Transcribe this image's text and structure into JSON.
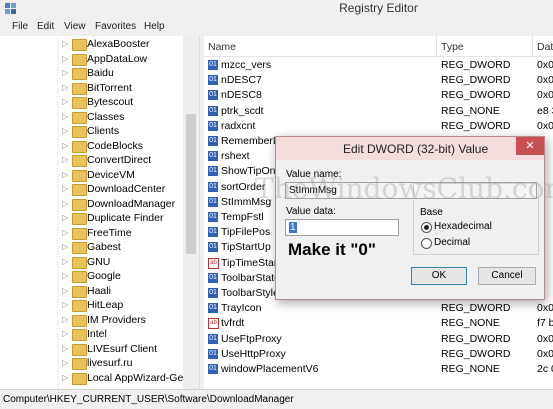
{
  "window": {
    "title": "Registry Editor"
  },
  "menu": [
    "File",
    "Edit",
    "View",
    "Favorites",
    "Help"
  ],
  "tree": {
    "items": [
      "AlexaBooster",
      "AppDataLow",
      "Baidu",
      "BitTorrent",
      "Bytescout",
      "Classes",
      "Clients",
      "CodeBlocks",
      "ConvertDirect",
      "DeviceVM",
      "DownloadCenter",
      "DownloadManager",
      "Duplicate Finder",
      "FreeTime",
      "Gabest",
      "GNU",
      "Google",
      "Haali",
      "HitLeap",
      "IM Providers",
      "Intel",
      "LIVEsurf Client",
      "livesurf.ru",
      "Local AppWizard-Gene"
    ]
  },
  "list": {
    "headers": {
      "name": "Name",
      "type": "Type",
      "data": "Data"
    },
    "rows": [
      {
        "icon": "dword-icon",
        "name": "mzcc_vers",
        "type": "REG_DWORD",
        "data": "0x0"
      },
      {
        "icon": "dword-icon",
        "name": "nDESC7",
        "type": "REG_DWORD",
        "data": "0x0"
      },
      {
        "icon": "dword-icon",
        "name": "nDESC8",
        "type": "REG_DWORD",
        "data": "0x0"
      },
      {
        "icon": "dword-icon",
        "name": "ptrk_scdt",
        "type": "REG_NONE",
        "data": "e8 3"
      },
      {
        "icon": "dword-icon",
        "name": "radxcnt",
        "type": "REG_DWORD",
        "data": "0x0"
      },
      {
        "icon": "dword-icon",
        "name": "RememberL",
        "type": "",
        "data": ""
      },
      {
        "icon": "dword-icon",
        "name": "rshext",
        "type": "",
        "data": ""
      },
      {
        "icon": "dword-icon",
        "name": "ShowTipOnF",
        "type": "",
        "data": ""
      },
      {
        "icon": "dword-icon",
        "name": "sortOrder",
        "type": "",
        "data": ""
      },
      {
        "icon": "dword-icon",
        "name": "StImmMsg",
        "type": "",
        "data": ""
      },
      {
        "icon": "dword-icon",
        "name": "TempFstl",
        "type": "",
        "data": ""
      },
      {
        "icon": "dword-icon",
        "name": "TipFilePos",
        "type": "",
        "data": ""
      },
      {
        "icon": "dword-icon",
        "name": "TipStartUp",
        "type": "",
        "data": ""
      },
      {
        "icon": "string-icon",
        "name": "TipTimeStan",
        "type": "",
        "data": ""
      },
      {
        "icon": "dword-icon",
        "name": "ToolbarState",
        "type": "",
        "data": ""
      },
      {
        "icon": "dword-icon",
        "name": "ToolbarStyle",
        "type": "",
        "data": ""
      },
      {
        "icon": "dword-icon",
        "name": "TrayIcon",
        "type": "REG_DWORD",
        "data": "0x0"
      },
      {
        "icon": "string-icon",
        "name": "tvfrdt",
        "type": "REG_NONE",
        "data": "f7 b"
      },
      {
        "icon": "dword-icon",
        "name": "UseFtpProxy",
        "type": "REG_DWORD",
        "data": "0x0"
      },
      {
        "icon": "dword-icon",
        "name": "UseHttpProxy",
        "type": "REG_DWORD",
        "data": "0x0"
      },
      {
        "icon": "dword-icon",
        "name": "windowPlacementV6",
        "type": "REG_NONE",
        "data": "2c 0"
      }
    ]
  },
  "statusbar": {
    "path": "Computer\\HKEY_CURRENT_USER\\Software\\DownloadManager"
  },
  "dialog": {
    "title": "Edit DWORD (32-bit) Value",
    "close": "✕",
    "value_name_label": "Value name:",
    "value_name": "StImmMsg",
    "value_data_label": "Value data:",
    "value_data": "1",
    "base_label": "Base",
    "hex_label": "Hexadecimal",
    "dec_label": "Decimal",
    "ok_label": "OK",
    "cancel_label": "Cancel"
  },
  "annotation": "Make it \"0\"",
  "watermark": "TheWindowsClub.com"
}
